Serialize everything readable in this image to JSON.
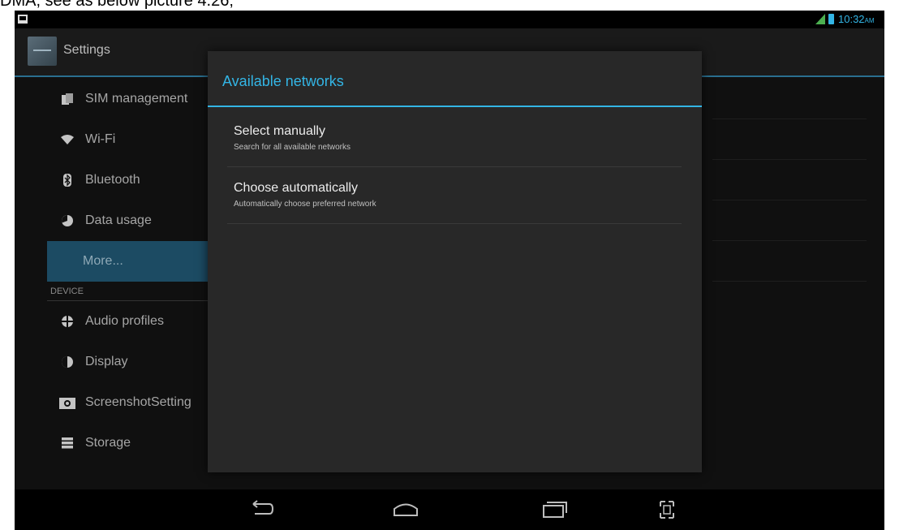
{
  "caption": "DMA, see as below picture 4.26;",
  "status_bar": {
    "notification_icon": "image-notification-icon",
    "signal_icon": "signal-icon",
    "battery_icon": "battery-icon",
    "time": "10:32",
    "time_suffix": "AM",
    "accent": "#33b5e5"
  },
  "action_bar": {
    "app_icon": "settings-app-icon",
    "title": "Settings"
  },
  "settings": {
    "items": [
      {
        "label": "SIM management",
        "icon": "sim-icon"
      },
      {
        "label": "Wi-Fi",
        "icon": "wifi-icon"
      },
      {
        "label": "Bluetooth",
        "icon": "bluetooth-icon"
      },
      {
        "label": "Data usage",
        "icon": "data-usage-icon"
      },
      {
        "label": "More...",
        "icon": ""
      }
    ],
    "device_header": "DEVICE",
    "device_items": [
      {
        "label": "Audio profiles",
        "icon": "audio-profiles-icon"
      },
      {
        "label": "Display",
        "icon": "display-icon"
      },
      {
        "label": "ScreenshotSetting",
        "icon": "screenshot-icon"
      },
      {
        "label": "Storage",
        "icon": "storage-icon"
      }
    ],
    "selected_color": "#1c4b63"
  },
  "dialog": {
    "title": "Available networks",
    "items": [
      {
        "title": "Select manually",
        "subtitle": "Search for all available networks"
      },
      {
        "title": "Choose automatically",
        "subtitle": "Automatically choose preferred network"
      }
    ]
  },
  "nav_bar": {
    "back_icon": "back-icon",
    "home_icon": "home-icon",
    "recents_icon": "recent-apps-icon",
    "screenshot_icon": "screenshot-capture-icon"
  }
}
